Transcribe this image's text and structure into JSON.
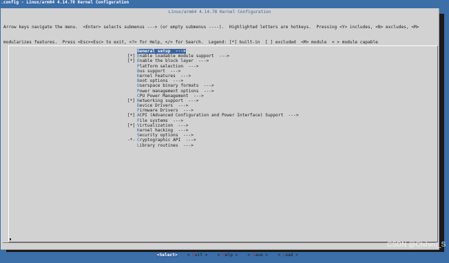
{
  "window": {
    "title": ".config - Linux/arm64 4.14.78 Kernel Configuration"
  },
  "dialog": {
    "title": "Linux/arm64 4.14.78 Kernel Configuration",
    "help_line_1": "Arrow keys navigate the menu.  <Enter> selects submenus ---> (or empty submenus ----).  Highlighted letters are hotkeys.  Pressing <Y> includes, <N> excludes, <M>",
    "help_line_2": "modularizes features.  Press <Esc><Esc> to exit, <?> for Help, </> for Search.  Legend: [*] built-in  [ ] excluded  <M> module  < > module capable"
  },
  "menu": {
    "items": [
      {
        "prefix": "",
        "hot": "G",
        "rest": "eneral setup  --->",
        "selected": true
      },
      {
        "prefix": "[*]",
        "hot": "E",
        "rest": "nable loadable module support  --->",
        "selected": false
      },
      {
        "prefix": "[*]",
        "hot": "E",
        "rest": "nable the block layer  --->",
        "selected": false
      },
      {
        "prefix": "",
        "hot": "P",
        "rest": "latform selection  --->",
        "selected": false
      },
      {
        "prefix": "",
        "hot": "B",
        "rest": "us support  --->",
        "selected": false
      },
      {
        "prefix": "",
        "hot": "K",
        "rest": "ernel Features  --->",
        "selected": false
      },
      {
        "prefix": "",
        "hot": "B",
        "rest": "oot options  --->",
        "selected": false
      },
      {
        "prefix": "",
        "hot": "U",
        "rest": "serspace binary formats  --->",
        "selected": false
      },
      {
        "prefix": "",
        "hot": "P",
        "rest": "ower management options  --->",
        "selected": false
      },
      {
        "prefix": "",
        "hot": "C",
        "rest": "PU Power Management  --->",
        "selected": false
      },
      {
        "prefix": "[*]",
        "hot": "N",
        "rest": "etworking support  --->",
        "selected": false
      },
      {
        "prefix": "",
        "hot": "D",
        "rest": "evice Drivers  --->",
        "selected": false
      },
      {
        "prefix": "",
        "hot": "F",
        "rest": "irmware Drivers  --->",
        "selected": false
      },
      {
        "prefix": "[*]",
        "hot": "A",
        "rest": "CPI (Advanced Configuration and Power Interface) Support  --->",
        "selected": false
      },
      {
        "prefix": "",
        "hot": "F",
        "rest": "ile systems  --->",
        "selected": false
      },
      {
        "prefix": "[*]",
        "hot": "V",
        "rest": "irtualization  --->",
        "selected": false
      },
      {
        "prefix": "",
        "hot": "K",
        "rest": "ernel hacking  --->",
        "selected": false
      },
      {
        "prefix": "",
        "hot": "S",
        "rest": "ecurity options  --->",
        "selected": false
      },
      {
        "prefix": "-*-",
        "hot": "C",
        "rest": "ryptographic API  --->",
        "selected": false
      },
      {
        "prefix": "",
        "hot": "L",
        "rest": "ibrary routines  --->",
        "selected": false
      }
    ]
  },
  "buttons": {
    "select": {
      "open": "<",
      "hk": "S",
      "rest": "elect>"
    },
    "exit": {
      "open": "< ",
      "hk": "E",
      "rest": "xit >"
    },
    "help": {
      "open": "< ",
      "hk": "H",
      "rest": "elp >"
    },
    "save": {
      "open": "< ",
      "hk": "S",
      "rest": "ave >"
    },
    "load": {
      "open": "< ",
      "hk": "L",
      "rest": "oad >"
    }
  },
  "watermark": "CSDN @Chihiro_S",
  "colors": {
    "background": "#3c6ea8",
    "dialog": "#d2d2d2",
    "accent": "#3a63a0",
    "hotkey_button": "#b03030"
  }
}
